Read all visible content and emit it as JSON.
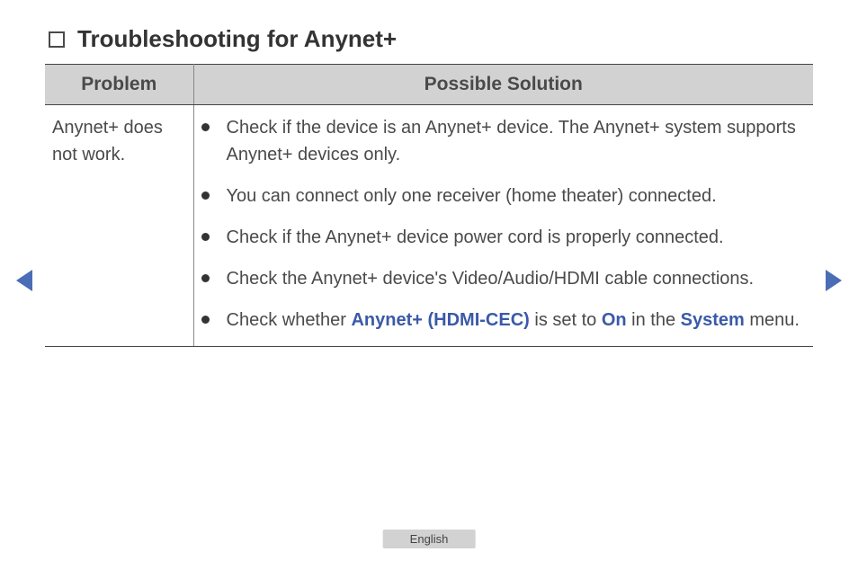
{
  "heading": "Troubleshooting for Anynet+",
  "table": {
    "headers": {
      "problem": "Problem",
      "solution": "Possible Solution"
    },
    "row": {
      "problem": "Anynet+ does not work.",
      "solutions": {
        "s1": "Check if the device is an Anynet+ device. The Anynet+ system supports Anynet+ devices only.",
        "s2": "You can connect only one receiver (home theater) connected.",
        "s3": "Check if the Anynet+ device power cord is properly connected.",
        "s4": "Check the Anynet+ device's Video/Audio/HDMI cable connections.",
        "s5": {
          "pre": "Check whether ",
          "kw1": "Anynet+ (HDMI-CEC)",
          "mid1": " is set to ",
          "kw2": "On",
          "mid2": " in the ",
          "kw3": "System",
          "post": " menu."
        }
      }
    }
  },
  "footer": {
    "language": "English"
  }
}
